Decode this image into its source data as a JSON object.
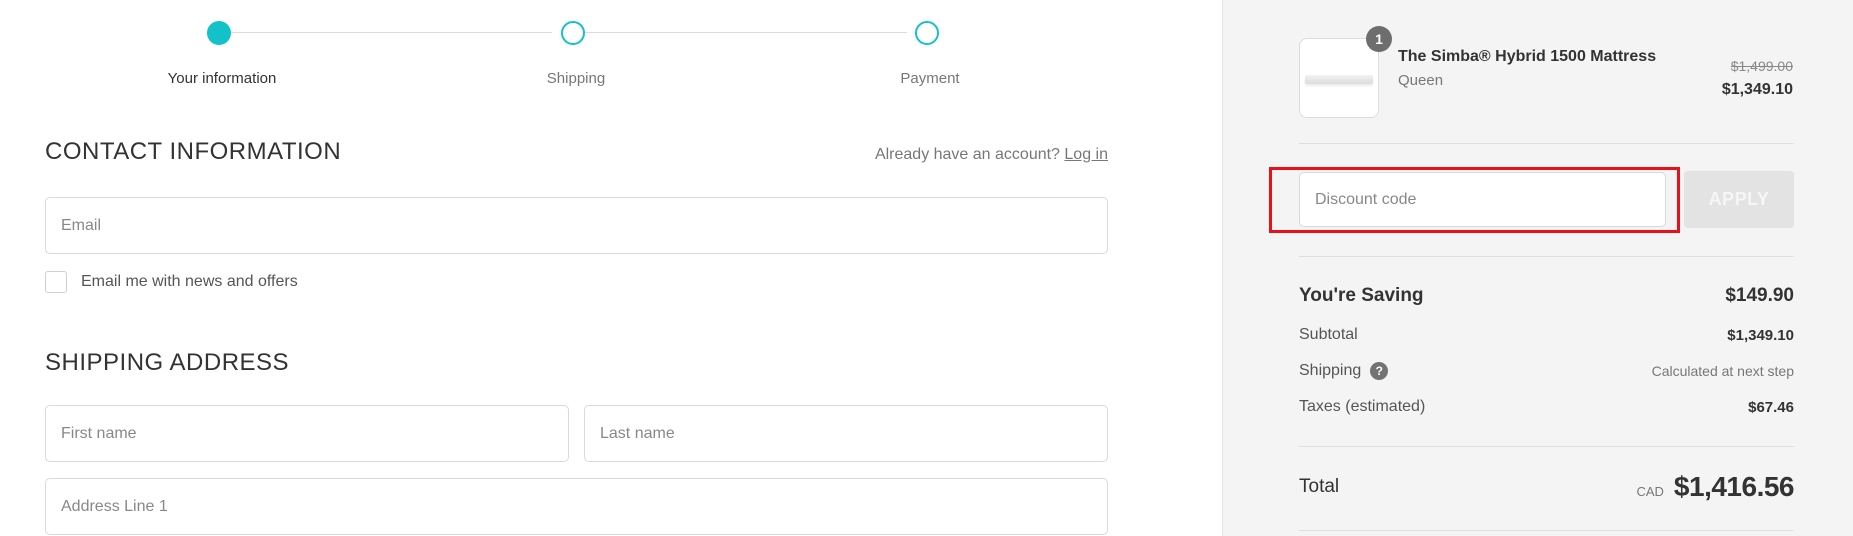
{
  "steps": [
    {
      "label": "Your information",
      "active": true
    },
    {
      "label": "Shipping",
      "active": false
    },
    {
      "label": "Payment",
      "active": false
    }
  ],
  "contact": {
    "title": "CONTACT INFORMATION",
    "account_prompt": "Already have an account?",
    "login_link": "Log in",
    "email_placeholder": "Email",
    "newsletter_label": "Email me with news and offers"
  },
  "shipping": {
    "title": "SHIPPING ADDRESS",
    "first_name_placeholder": "First name",
    "last_name_placeholder": "Last name",
    "address1_placeholder": "Address Line 1"
  },
  "cart": {
    "quantity": "1",
    "product_name": "The Simba® Hybrid 1500 Mattress",
    "variant": "Queen",
    "price_original": "$1,499.00",
    "price_current": "$1,349.10"
  },
  "discount": {
    "placeholder": "Discount code",
    "apply_label": "APPLY"
  },
  "summary": {
    "saving_label": "You're Saving",
    "saving_value": "$149.90",
    "subtotal_label": "Subtotal",
    "subtotal_value": "$1,349.10",
    "shipping_label": "Shipping",
    "shipping_help": "?",
    "shipping_value": "Calculated at next step",
    "taxes_label": "Taxes (estimated)",
    "taxes_value": "$67.46",
    "total_label": "Total",
    "currency": "CAD",
    "total_value": "$1,416.56"
  },
  "colors": {
    "accent": "#13c2c9",
    "highlight": "#e8101a"
  }
}
